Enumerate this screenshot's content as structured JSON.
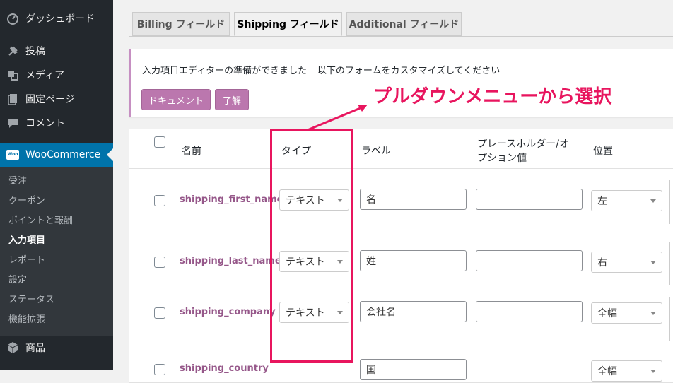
{
  "sidebar": {
    "items": [
      {
        "label": "ダッシュボード",
        "icon": "dashboard-icon"
      },
      {
        "label": "投稿",
        "icon": "pin-icon"
      },
      {
        "label": "メディア",
        "icon": "media-icon"
      },
      {
        "label": "固定ページ",
        "icon": "page-icon"
      },
      {
        "label": "コメント",
        "icon": "comment-icon"
      }
    ],
    "woocommerce": {
      "label": "WooCommerce",
      "icon_text": "Woo"
    },
    "submenu": [
      "受注",
      "クーポン",
      "ポイントと報酬",
      "入力項目",
      "レポート",
      "設定",
      "ステータス",
      "機能拡張"
    ],
    "current_submenu": "入力項目",
    "products": {
      "label": "商品",
      "icon": "box-icon"
    }
  },
  "tabs": [
    {
      "label": "Billing フィールド",
      "active": false
    },
    {
      "label": "Shipping フィールド",
      "active": true
    },
    {
      "label": "Additional フィールド",
      "active": false
    }
  ],
  "notice": {
    "text": "入力項目エディターの準備ができました – 以下のフォームをカスタマイズしてください",
    "buttons": [
      "ドキュメント",
      "了解"
    ]
  },
  "table": {
    "headers": [
      "名前",
      "タイプ",
      "ラベル",
      "プレースホルダー/オ",
      "プション値",
      "位置"
    ],
    "rows": [
      {
        "name": "shipping_first_name",
        "type": "テキスト",
        "label": "名",
        "placeholder": "",
        "position": "左"
      },
      {
        "name": "shipping_last_name",
        "type": "テキスト",
        "label": "姓",
        "placeholder": "",
        "position": "右"
      },
      {
        "name": "shipping_company",
        "type": "テキスト",
        "label": "会社名",
        "placeholder": "",
        "position": "全幅"
      },
      {
        "name": "shipping_country",
        "type": "",
        "label": "国",
        "placeholder": "",
        "position": "全幅"
      }
    ]
  },
  "annotation": {
    "text": "プルダウンメニューから選択",
    "color": "#e8155e"
  },
  "colors": {
    "sidebar_bg": "#23282d",
    "woo_accent": "#0073aa",
    "woo_purple": "#96588a",
    "button_purple": "#bb77ae"
  }
}
